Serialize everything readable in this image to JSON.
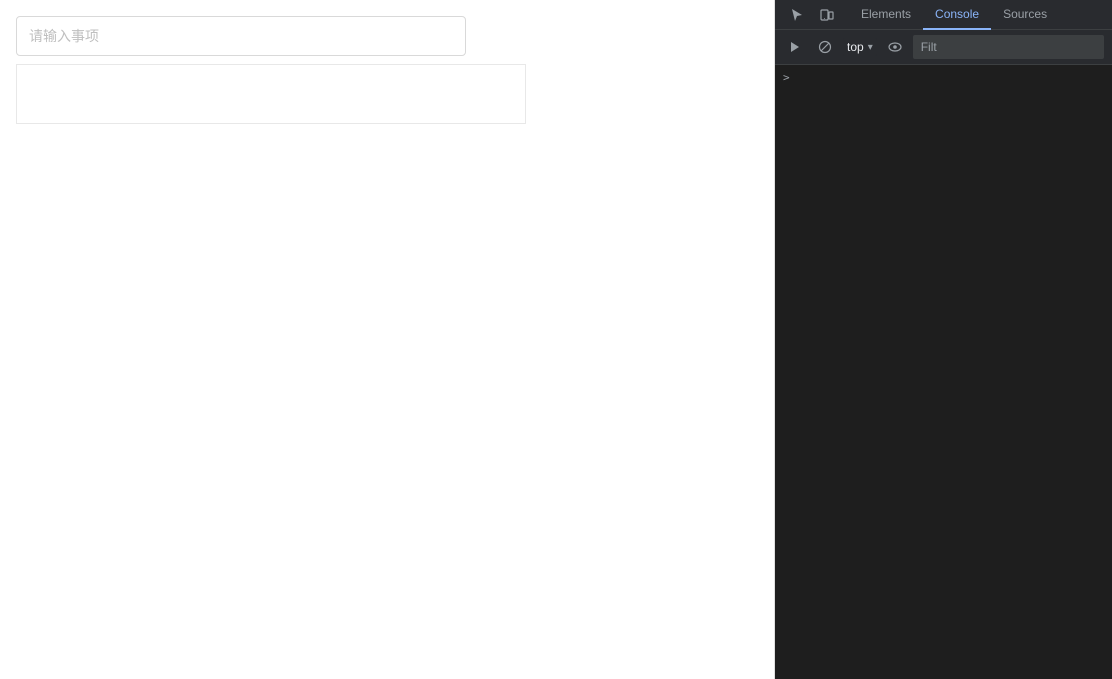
{
  "mainPanel": {
    "input": {
      "placeholder": "请输入事项"
    }
  },
  "devtools": {
    "toolbar": {
      "inspect_label": "Inspect",
      "device_label": "Toggle device toolbar"
    },
    "tabs": [
      {
        "id": "elements",
        "label": "Elements",
        "active": false
      },
      {
        "id": "console",
        "label": "Console",
        "active": true
      },
      {
        "id": "sources",
        "label": "Sources",
        "active": false
      }
    ],
    "toolbar2": {
      "run_label": "Run",
      "block_label": "Block",
      "context": "top",
      "context_chevron": "▾",
      "eye_label": "Custom formatters",
      "filter_placeholder": "Filt"
    },
    "console": {
      "prompt_arrow": ">"
    }
  }
}
